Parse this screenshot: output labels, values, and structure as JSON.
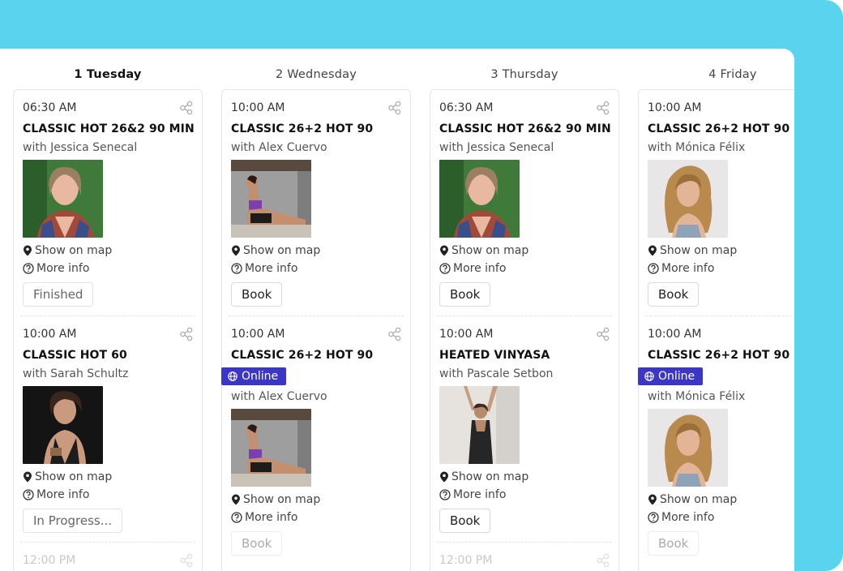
{
  "days": [
    {
      "label": "1 Tuesday",
      "active": true,
      "classes": [
        {
          "time": "06:30 AM",
          "title": "CLASSIC HOT 26&2 90 MIN",
          "teacher": "with Jessica Senecal",
          "photo": "jessica",
          "online": false,
          "map": "Show on map",
          "info": "More info",
          "button": "Finished",
          "button_state": "muted"
        },
        {
          "time": "10:00 AM",
          "title": "CLASSIC HOT 60",
          "teacher": "with Sarah Schultz",
          "photo": "sarah",
          "online": false,
          "map": "Show on map",
          "info": "More info",
          "button": "In Progress...",
          "button_state": "muted"
        },
        {
          "time": "12:00 PM",
          "faded": true
        }
      ]
    },
    {
      "label": "2 Wednesday",
      "active": false,
      "classes": [
        {
          "time": "10:00 AM",
          "title": "CLASSIC 26+2 HOT 90",
          "teacher": "with Alex Cuervo",
          "photo": "alex",
          "online": false,
          "map": "Show on map",
          "info": "More info",
          "button": "Book",
          "button_state": "normal"
        },
        {
          "time": "10:00 AM",
          "title": "CLASSIC 26+2 HOT 90",
          "teacher": "with Alex Cuervo",
          "photo": "alex",
          "online": true,
          "online_label": "Online",
          "map": "Show on map",
          "info": "More info",
          "button": "Book",
          "button_state": "faded"
        }
      ]
    },
    {
      "label": "3 Thursday",
      "active": false,
      "classes": [
        {
          "time": "06:30 AM",
          "title": "CLASSIC HOT 26&2 90 MIN",
          "teacher": "with Jessica Senecal",
          "photo": "jessica",
          "online": false,
          "map": "Show on map",
          "info": "More info",
          "button": "Book",
          "button_state": "normal"
        },
        {
          "time": "10:00 AM",
          "title": "HEATED VINYASA",
          "teacher": "with Pascale Setbon",
          "photo": "pascale",
          "online": false,
          "map": "Show on map",
          "info": "More info",
          "button": "Book",
          "button_state": "normal"
        },
        {
          "time": "12:00 PM",
          "faded": true
        }
      ]
    },
    {
      "label": "4 Friday",
      "active": false,
      "classes": [
        {
          "time": "10:00 AM",
          "title": "CLASSIC 26+2 HOT 90",
          "teacher": "with Mónica Félix",
          "photo": "monica",
          "online": false,
          "map": "Show on map",
          "info": "More info",
          "button": "Book",
          "button_state": "normal"
        },
        {
          "time": "10:00 AM",
          "title": "CLASSIC 26+2 HOT 90",
          "teacher": "with Mónica Félix",
          "photo": "monica",
          "online": true,
          "online_label": "Online",
          "map": "Show on map",
          "info": "More info",
          "button": "Book",
          "button_state": "faded"
        }
      ]
    }
  ],
  "icons": {
    "share": "share-icon",
    "map": "map-pin-icon",
    "info": "question-circle-icon",
    "online": "globe-icon"
  },
  "colors": {
    "accent_background": "#5ad3ee",
    "online_badge": "#3c36c7"
  }
}
